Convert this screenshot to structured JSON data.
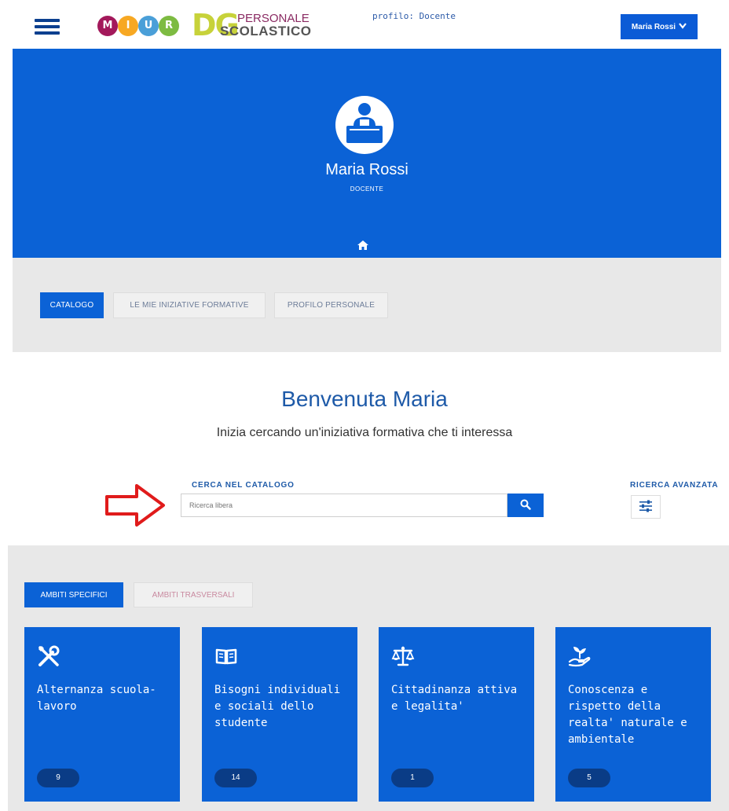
{
  "header": {
    "logo_letters": [
      "M",
      "I",
      "U",
      "R"
    ],
    "logo_colors": [
      "#a3195b",
      "#f7a823",
      "#4a9fd8",
      "#7dbb42"
    ],
    "dg_letters": "DG",
    "dg_line1": "PERSONALE",
    "dg_line2": "SCOLASTICO",
    "profile_text": "profilo: Docente",
    "user_button_label": "Maria Rossi"
  },
  "hero": {
    "name": "Maria Rossi",
    "role": "DOCENTE"
  },
  "nav_tabs": [
    {
      "label": "CATALOGO",
      "active": true
    },
    {
      "label": "LE MIE INIZIATIVE FORMATIVE",
      "active": false
    },
    {
      "label": "PROFILO PERSONALE",
      "active": false
    }
  ],
  "welcome": {
    "title": "Benvenuta Maria",
    "subtitle": "Inizia cercando un'iniziativa formativa che ti interessa"
  },
  "search": {
    "label": "CERCA NEL CATALOGO",
    "placeholder": "Ricerca libera",
    "advanced_label": "RICERCA AVANZATA"
  },
  "ambiti_tabs": [
    {
      "label": "AMBITI SPECIFICI",
      "active": true
    },
    {
      "label": "AMBITI TRASVERSALI",
      "active": false
    }
  ],
  "cards": [
    {
      "icon": "tools-icon",
      "title": "Alternanza scuola-lavoro",
      "count": "9"
    },
    {
      "icon": "book-icon",
      "title": "Bisogni individuali e sociali dello studente",
      "count": "14"
    },
    {
      "icon": "scales-icon",
      "title": "Cittadinanza attiva e legalita'",
      "count": "1"
    },
    {
      "icon": "hand-plant-icon",
      "title": "Conoscenza e rispetto della realta' naturale e ambientale",
      "count": "5"
    }
  ],
  "colors": {
    "primary": "#0b62d6",
    "band": "#e8e8e8",
    "badge": "#0a3c86",
    "arrow": "#e01b1b"
  }
}
